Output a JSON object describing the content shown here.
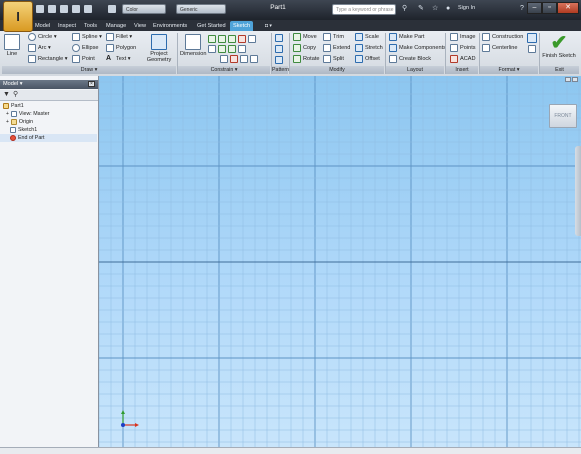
{
  "window": {
    "document_title": "Part1",
    "search_placeholder": "Type a keyword or phrase",
    "sign_in_label": "Sign In",
    "style_dropdown": "Color",
    "material_dropdown": "Generic"
  },
  "tabs": [
    {
      "label": "Model"
    },
    {
      "label": "Inspect"
    },
    {
      "label": "Tools"
    },
    {
      "label": "Manage"
    },
    {
      "label": "View"
    },
    {
      "label": "Environments"
    },
    {
      "label": "Get Started"
    },
    {
      "label": "Sketch"
    }
  ],
  "ribbon": {
    "draw": {
      "panel_label": "Draw ▾",
      "line": "Line",
      "circle": "Circle ▾",
      "arc": "Arc ▾",
      "rectangle": "Rectangle ▾",
      "spline": "Spline ▾",
      "ellipse": "Ellipse",
      "point": "Point",
      "fillet": "Fillet ▾",
      "polygon": "Polygon",
      "text": "Text ▾",
      "project_geometry": "Project Geometry"
    },
    "constrain": {
      "panel_label": "Constrain ▾",
      "dimension": "Dimension"
    },
    "pattern": {
      "panel_label": "Pattern"
    },
    "modify": {
      "panel_label": "Modify",
      "move": "Move",
      "copy": "Copy",
      "rotate": "Rotate",
      "trim": "Trim",
      "extend": "Extend",
      "split": "Split",
      "scale": "Scale",
      "stretch": "Stretch",
      "offset": "Offset"
    },
    "layout": {
      "panel_label": "Layout",
      "make_part": "Make Part",
      "make_components": "Make Components",
      "create_block": "Create Block"
    },
    "insert": {
      "panel_label": "Insert",
      "image": "Image",
      "points": "Points",
      "acad": "ACAD"
    },
    "format": {
      "panel_label": "Format ▾",
      "construction": "Construction",
      "centerline": "Centerline"
    },
    "exit": {
      "panel_label": "Exit",
      "finish_sketch": "Finish Sketch"
    }
  },
  "browser": {
    "title": "Model ▾",
    "tree": [
      {
        "label": "Part1"
      },
      {
        "label": "View: Master"
      },
      {
        "label": "Origin"
      },
      {
        "label": "Sketch1"
      },
      {
        "label": "End of Part"
      }
    ]
  },
  "canvas": {
    "viewcube_label": "FRONT"
  }
}
